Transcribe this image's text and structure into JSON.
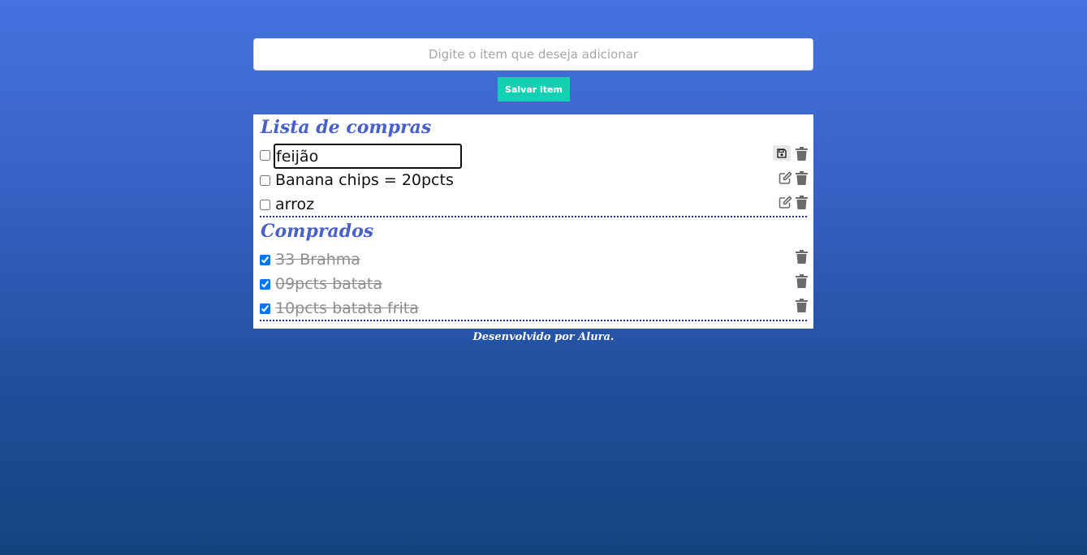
{
  "form": {
    "placeholder": "Digite o item que deseja adicionar",
    "value": "",
    "save_label": "Salvar item"
  },
  "shopping_list": {
    "title": "Lista de compras",
    "items": [
      {
        "label": "feijão",
        "checked": false,
        "editing": true
      },
      {
        "label": "Banana chips = 20pcts",
        "checked": false,
        "editing": false
      },
      {
        "label": "arroz",
        "checked": false,
        "editing": false
      }
    ]
  },
  "bought": {
    "title": "Comprados",
    "items": [
      {
        "label": "33 Brahma",
        "checked": true
      },
      {
        "label": "09pcts batata",
        "checked": true
      },
      {
        "label": "10pcts batata frita",
        "checked": true
      }
    ]
  },
  "footer": {
    "text": "Desenvolvido por Alura."
  },
  "colors": {
    "accent": "#12d1b3",
    "title": "#4a5fc8",
    "icon": "#6b6b6b"
  },
  "icons": {
    "edit": "pencil-square-icon",
    "delete": "trash-icon",
    "save": "floppy-disk-icon"
  }
}
